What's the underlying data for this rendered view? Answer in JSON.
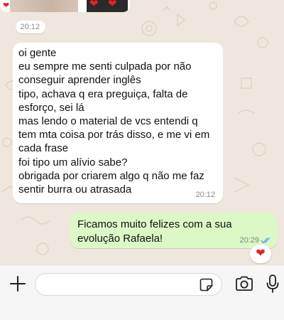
{
  "chat": {
    "top_image": {
      "reaction_icons": [
        "heart-icon",
        "heart-icon",
        "heart-icon"
      ]
    },
    "timestamp_bubble": {
      "time": "20:12"
    },
    "incoming_message": {
      "lines": [
        "oi gente",
        "eu sempre me senti culpada por não",
        "conseguir aprender inglês",
        "tipo, achava q era preguiça, falta de",
        "esforço, sei lá",
        "mas lendo o material de vcs entendi q",
        "tem mta coisa por trás disso, e me vi em",
        "cada frase",
        "foi tipo um alívio sabe?",
        "obrigada por criarem algo q não me faz",
        "sentir burra ou atrasada"
      ],
      "time": "20:12"
    },
    "outgoing_message": {
      "lines": [
        "Ficamos muito felizes com a sua",
        "evolução Rafaela!"
      ],
      "time": "20:29",
      "status_icon": "double-check-icon",
      "reaction": "❤"
    }
  },
  "composer": {
    "input_value": "",
    "icons": {
      "add": "plus-icon",
      "sticker": "sticker-icon",
      "camera": "camera-icon",
      "mic": "microphone-icon"
    }
  },
  "colors": {
    "chat_background": "#efe7dd",
    "incoming_bubble": "#ffffff",
    "outgoing_bubble": "#dcf8c6",
    "read_ticks": "#4fa6e8",
    "heart": "#e0232a"
  }
}
